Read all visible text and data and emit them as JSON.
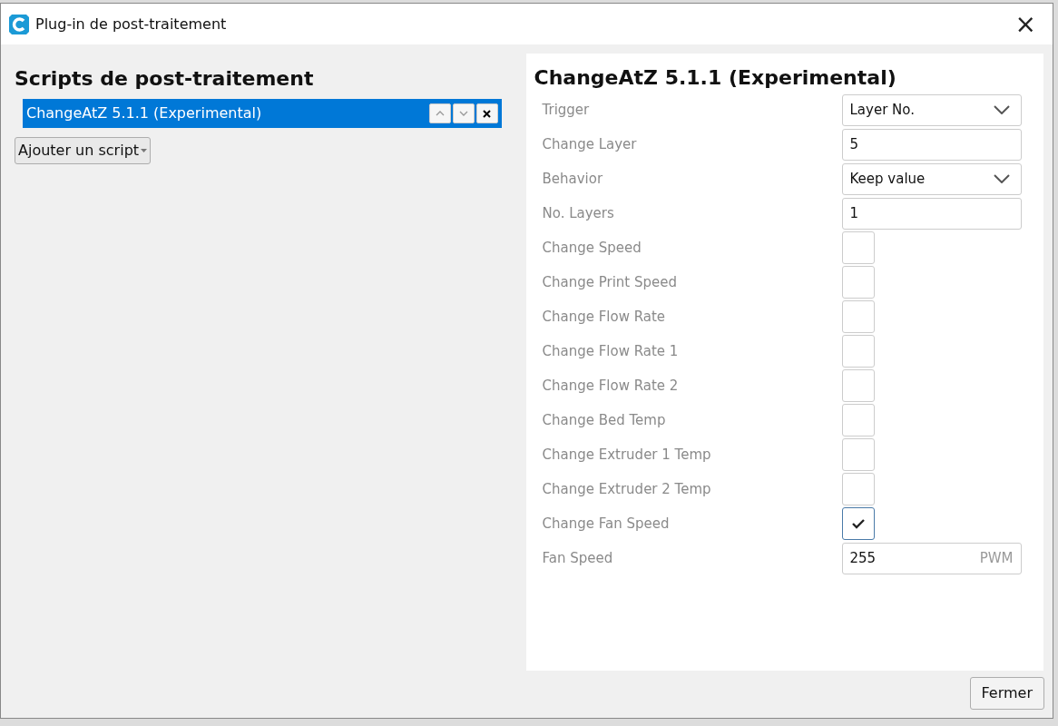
{
  "window": {
    "title": "Plug-in de post-traitement",
    "close": "×"
  },
  "scripts_panel": {
    "title": "Scripts de post-traitement",
    "scripts": [
      {
        "name": "ChangeAtZ 5.1.1 (Experimental)",
        "selected": true
      }
    ],
    "add_button": "Ajouter un script"
  },
  "settings_panel": {
    "title": "ChangeAtZ 5.1.1 (Experimental)",
    "settings": [
      {
        "label": "Trigger",
        "kind": "select",
        "value": "Layer No."
      },
      {
        "label": "Change Layer",
        "kind": "text",
        "value": "5"
      },
      {
        "label": "Behavior",
        "kind": "select",
        "value": "Keep value"
      },
      {
        "label": "No. Layers",
        "kind": "text",
        "value": "1"
      },
      {
        "label": "Change Speed",
        "kind": "checkbox",
        "checked": false
      },
      {
        "label": "Change Print Speed",
        "kind": "checkbox",
        "checked": false
      },
      {
        "label": "Change Flow Rate",
        "kind": "checkbox",
        "checked": false
      },
      {
        "label": "Change Flow Rate 1",
        "kind": "checkbox",
        "checked": false
      },
      {
        "label": "Change Flow Rate 2",
        "kind": "checkbox",
        "checked": false
      },
      {
        "label": "Change Bed Temp",
        "kind": "checkbox",
        "checked": false
      },
      {
        "label": "Change Extruder 1 Temp",
        "kind": "checkbox",
        "checked": false
      },
      {
        "label": "Change Extruder 2 Temp",
        "kind": "checkbox",
        "checked": false
      },
      {
        "label": "Change Fan Speed",
        "kind": "checkbox",
        "checked": true
      },
      {
        "label": "Fan Speed",
        "kind": "text",
        "value": "255",
        "unit": "PWM"
      }
    ]
  },
  "close_button": "Fermer"
}
